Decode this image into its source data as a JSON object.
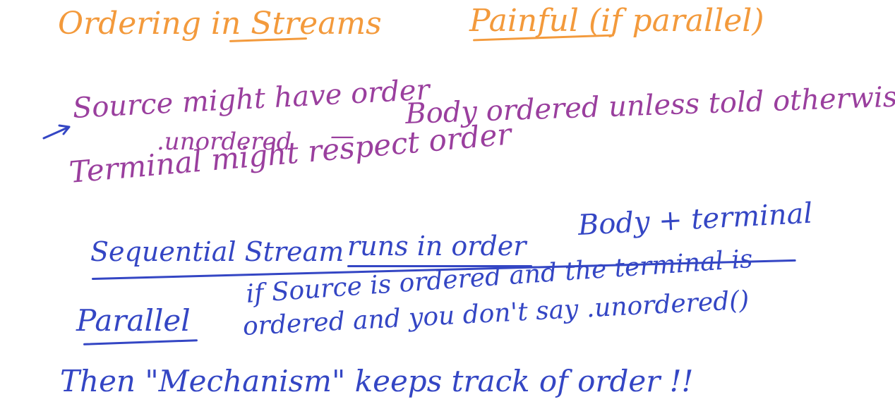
{
  "title": {
    "left": "Ordering in Streams",
    "right": "Painful (if parallel)"
  },
  "notes": {
    "source_line": "Source might have order",
    "unordered": ".unordered",
    "dash": "—",
    "body_line": "Body ordered unless told otherwise",
    "terminal_line": "Terminal might respect order",
    "sequential_stream": "Sequential Stream",
    "runs_in_order": "runs in order",
    "body_terminal": "Body + terminal",
    "parallel": "Parallel",
    "parallel_cond_1": "if Source is ordered and the terminal is",
    "parallel_cond_2": "ordered and you don't say .unordered()",
    "mechanism_line": "Then \"Mechanism\" keeps track of order !!"
  },
  "colors": {
    "title": "#f39a3c",
    "notes_top": "#9a3f9e",
    "notes_bottom": "#3446c4"
  },
  "icons": {
    "arrow": "arrow-right-icon"
  }
}
